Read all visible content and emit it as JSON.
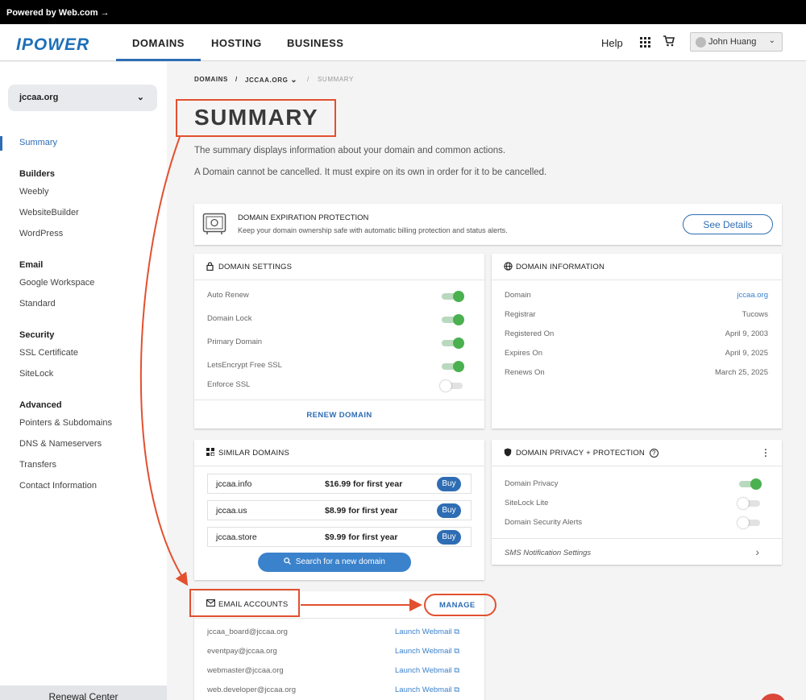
{
  "topbar": {
    "text": "Powered by Web.com",
    "arrow": "→"
  },
  "header": {
    "logo": "IPOWER",
    "tabs": [
      {
        "label": "DOMAINS",
        "active": true
      },
      {
        "label": "HOSTING",
        "active": false
      },
      {
        "label": "BUSINESS",
        "active": false
      }
    ],
    "help": "Help",
    "user_name": "John Huang"
  },
  "sidebar": {
    "domain_select": "jccaa.org",
    "summary": "Summary",
    "groups": [
      {
        "title": "Builders",
        "items": [
          "Weebly",
          "WebsiteBuilder",
          "WordPress"
        ]
      },
      {
        "title": "Email",
        "items": [
          "Google Workspace",
          "Standard"
        ]
      },
      {
        "title": "Security",
        "items": [
          "SSL Certificate",
          "SiteLock"
        ]
      },
      {
        "title": "Advanced",
        "items": [
          "Pointers & Subdomains",
          "DNS & Nameservers",
          "Transfers",
          "Contact Information"
        ]
      }
    ],
    "renewal_center": "Renewal Center"
  },
  "breadcrumb": {
    "root": "DOMAINS",
    "sep": "/",
    "domain": "JCCAA.ORG",
    "current": "SUMMARY"
  },
  "page": {
    "title": "SUMMARY",
    "desc1": "The summary displays information about your domain and common actions.",
    "desc2": "A Domain cannot be cancelled. It must expire on its own in order for it to be cancelled."
  },
  "protection": {
    "title": "DOMAIN EXPIRATION PROTECTION",
    "text": "Keep your domain ownership safe with automatic billing protection and status alerts.",
    "button": "See Details"
  },
  "settings": {
    "title": "DOMAIN SETTINGS",
    "rows": [
      {
        "label": "Auto Renew",
        "on": true
      },
      {
        "label": "Domain Lock",
        "on": true
      },
      {
        "label": "Primary Domain",
        "on": true
      },
      {
        "label": "LetsEncrypt Free SSL",
        "on": true
      },
      {
        "label": "Enforce SSL",
        "on": false
      }
    ],
    "renew": "RENEW DOMAIN"
  },
  "info": {
    "title": "DOMAIN INFORMATION",
    "rows": [
      {
        "label": "Domain",
        "value": "jccaa.org"
      },
      {
        "label": "Registrar",
        "value": "Tucows"
      },
      {
        "label": "Registered On",
        "value": "April 9, 2003"
      },
      {
        "label": "Expires On",
        "value": "April 9, 2025"
      },
      {
        "label": "Renews On",
        "value": "March 25, 2025"
      }
    ]
  },
  "similar": {
    "title": "SIMILAR DOMAINS",
    "rows": [
      {
        "name": "jccaa.info",
        "price": "$16.99 for first year",
        "buy": "Buy"
      },
      {
        "name": "jccaa.us",
        "price": "$8.99 for first year",
        "buy": "Buy"
      },
      {
        "name": "jccaa.store",
        "price": "$9.99 for first year",
        "buy": "Buy"
      }
    ],
    "search": "Search for a new domain"
  },
  "privacy": {
    "title": "DOMAIN PRIVACY + PROTECTION",
    "rows": [
      {
        "label": "Domain Privacy",
        "on": true
      },
      {
        "label": "SiteLock Lite",
        "on": false
      },
      {
        "label": "Domain Security Alerts",
        "on": false
      }
    ],
    "sms": "SMS Notification Settings"
  },
  "email": {
    "title": "EMAIL ACCOUNTS",
    "manage": "MANAGE",
    "webmail_label": "Launch Webmail",
    "accounts": [
      "jccaa_board@jccaa.org",
      "eventpay@jccaa.org",
      "webmaster@jccaa.org",
      "web.developer@jccaa.org"
    ]
  },
  "colors": {
    "accent": "#2e6db4",
    "annotation": "#e2502f",
    "toggle_on": "#4bb04f"
  }
}
